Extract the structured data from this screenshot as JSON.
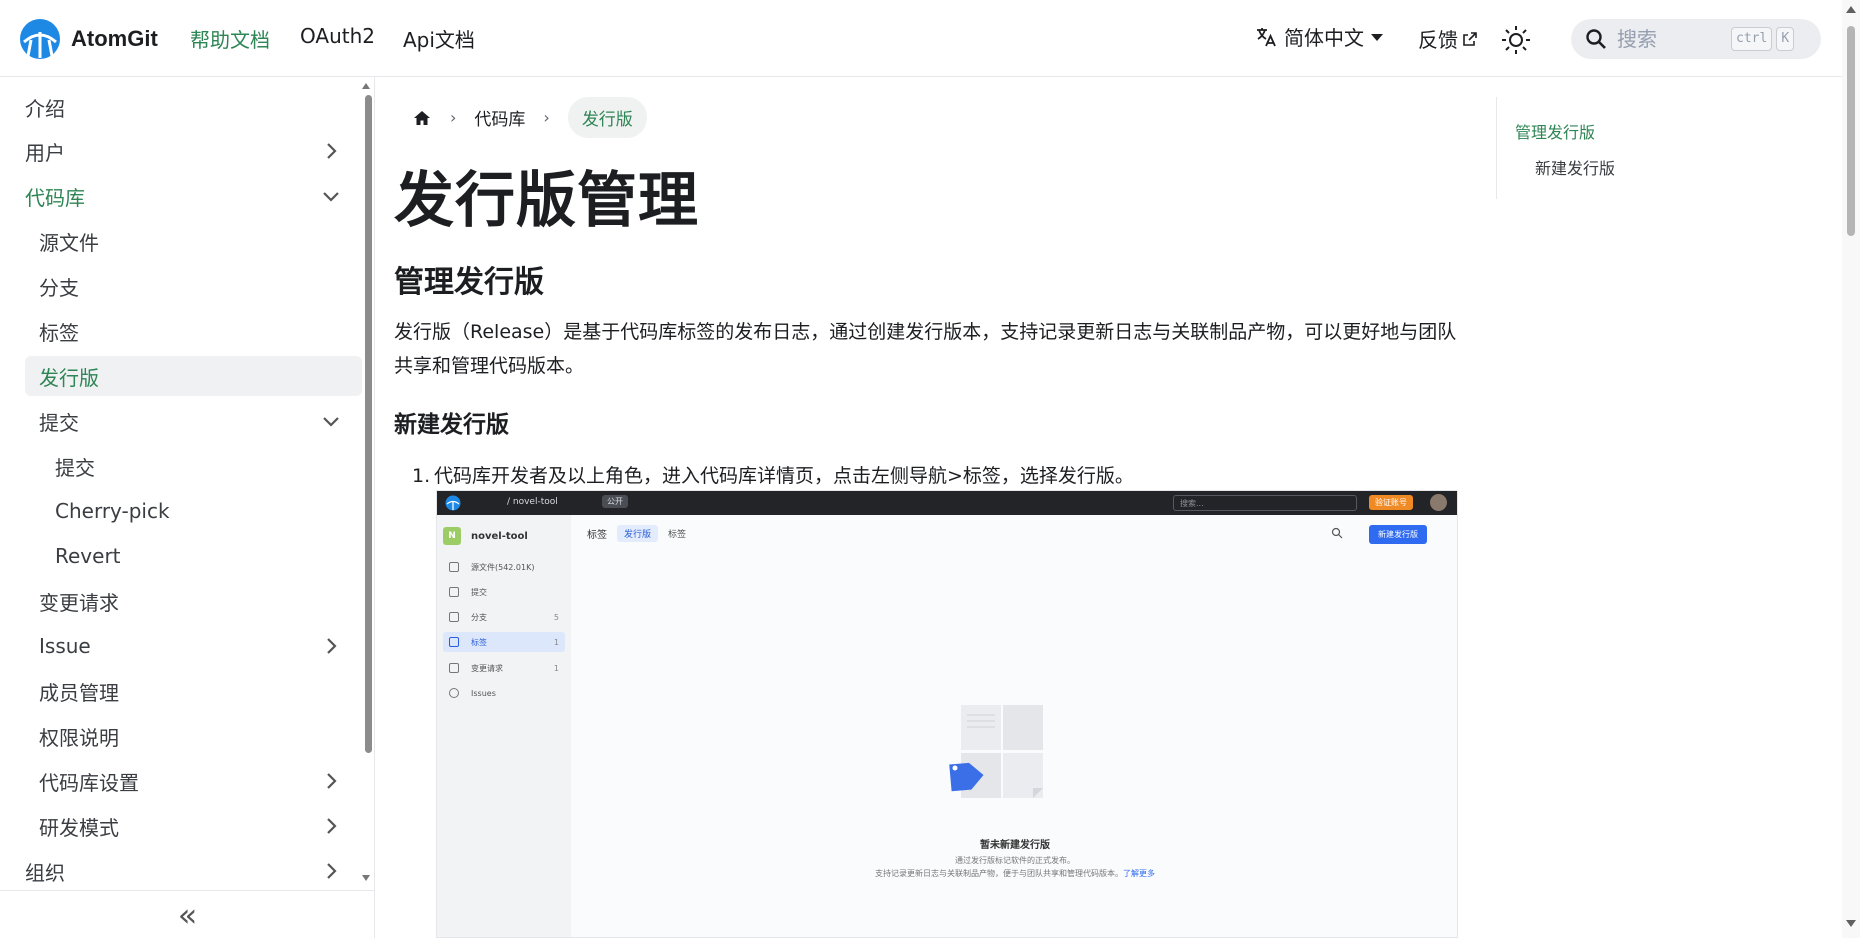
{
  "brand": {
    "name": "AtomGit",
    "logo_icon": "atomgit-logo-icon"
  },
  "navbar": {
    "links": [
      "帮助文档",
      "OAuth2",
      "Api文档"
    ],
    "language": "简体中文",
    "feedback": "反馈",
    "theme_icon": "sun-icon",
    "search": {
      "placeholder": "搜索",
      "shortcut_1": "ctrl",
      "shortcut_2": "K"
    }
  },
  "sidebar": {
    "items": [
      {
        "label": "介绍"
      },
      {
        "label": "用户"
      },
      {
        "label": "代码库"
      },
      {
        "label": "源文件"
      },
      {
        "label": "分支"
      },
      {
        "label": "标签"
      },
      {
        "label": "发行版"
      },
      {
        "label": "提交"
      },
      {
        "label": "提交"
      },
      {
        "label": "Cherry-pick"
      },
      {
        "label": "Revert"
      },
      {
        "label": "变更请求"
      },
      {
        "label": "Issue"
      },
      {
        "label": "成员管理"
      },
      {
        "label": "权限说明"
      },
      {
        "label": "代码库设置"
      },
      {
        "label": "研发模式"
      },
      {
        "label": "组织"
      }
    ],
    "collapse_label": "«"
  },
  "breadcrumb": {
    "home_icon": "home-icon",
    "items": [
      "代码库",
      "发行版"
    ]
  },
  "content": {
    "title": "发行版管理",
    "section_title": "管理发行版",
    "intro": "发行版（Release）是基于代码库标签的发布日志，通过创建发行版本，支持记录更新日志与关联制品产物，可以更好地与团队共享和管理代码版本。",
    "subsection_title": "新建发行版",
    "step_number": "1.",
    "step_text": "代码库开发者及以上角色，进入代码库详情页，点击左侧导航>标签，选择发行版。"
  },
  "screenshot": {
    "topbar": {
      "crumbs": "/ novel-tool",
      "public": "公开",
      "search": "搜索...",
      "verify": "验证账号"
    },
    "repo": {
      "badge": "N",
      "name": "novel-tool"
    },
    "nav": [
      {
        "label": "源文件(542.01K)",
        "count": ""
      },
      {
        "label": "提交",
        "count": ""
      },
      {
        "label": "分支",
        "count": "5"
      },
      {
        "label": "标签",
        "count": "1"
      },
      {
        "label": "变更请求",
        "count": "1"
      },
      {
        "label": "Issues",
        "count": ""
      }
    ],
    "tabs": {
      "main": "标签",
      "active": "发行版",
      "other": "标签"
    },
    "new_button": "新建发行版",
    "empty": {
      "title": "暂未新建发行版",
      "line1": "通过发行版标记软件的正式发布。",
      "line2": "支持记录更新日志与关联制品产物，便于与团队共享和管理代码版本。",
      "link": "了解更多"
    }
  },
  "toc": {
    "items": [
      "管理发行版",
      "新建发行版"
    ]
  },
  "colors": {
    "accent": "#2e8555",
    "link_blue": "#2f6bf0",
    "warn": "#f08a24"
  }
}
